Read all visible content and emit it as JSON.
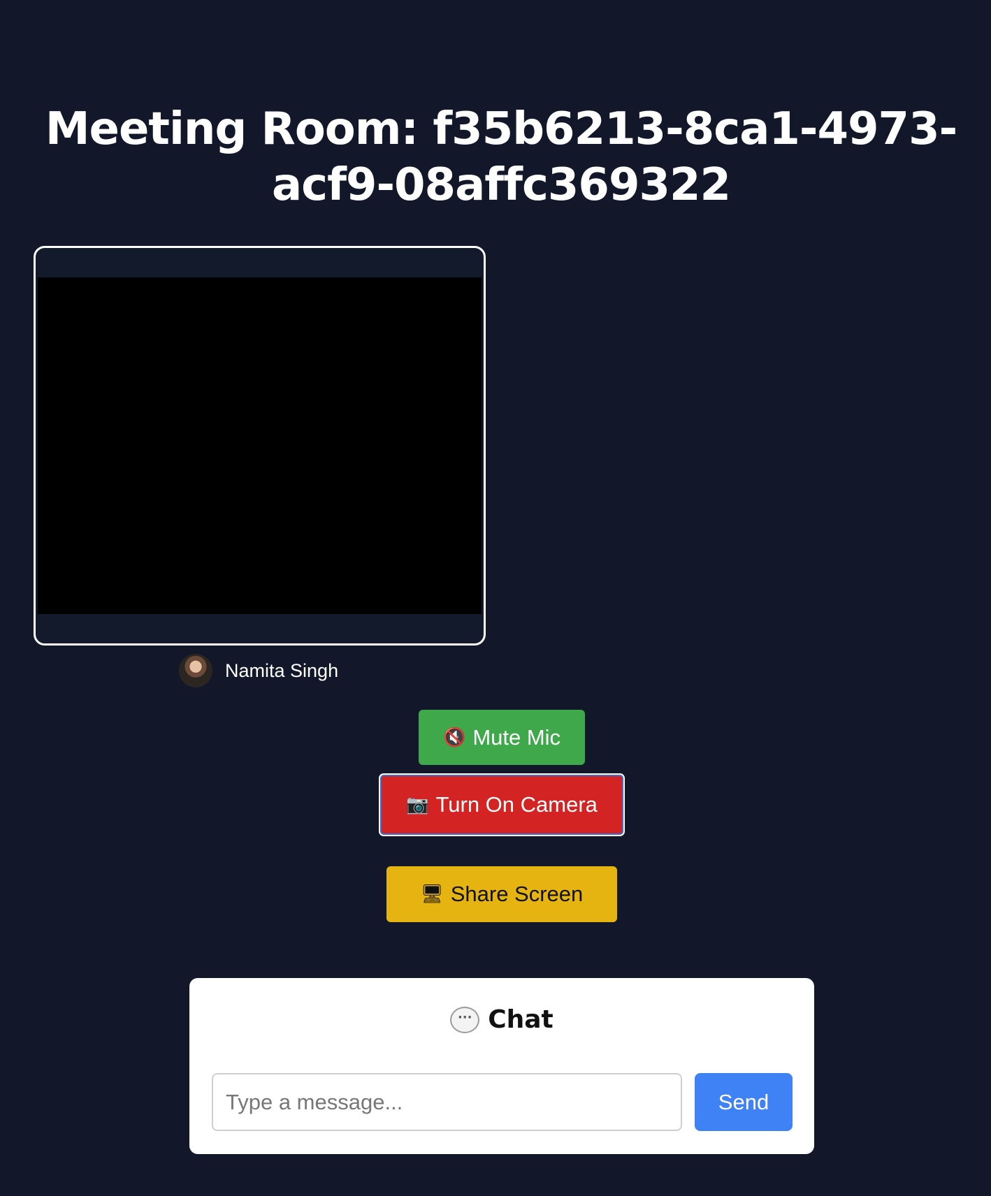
{
  "room": {
    "title": "Meeting Room: f35b6213-8ca1-4973-acf9-08affc369322"
  },
  "participants": [
    {
      "name": "Namita Singh",
      "avatar_icon": "user-avatar"
    }
  ],
  "controls": {
    "mute": {
      "icon": "🔇",
      "icon_name": "muted-speaker-icon",
      "label": "Mute Mic",
      "color": "#3ea84b"
    },
    "camera": {
      "icon": "📷",
      "icon_name": "camera-icon",
      "label": "Turn On Camera",
      "color": "#d32322"
    },
    "share": {
      "icon": "🖥",
      "icon_name": "monitor-icon",
      "label": "Share Screen",
      "color": "#e5b410"
    }
  },
  "chat": {
    "icon": "···",
    "icon_name": "speech-bubble-icon",
    "title": "Chat",
    "input_placeholder": "Type a message...",
    "input_value": "",
    "send_label": "Send",
    "send_color": "#3f82f6"
  },
  "theme": {
    "background": "#121829"
  }
}
